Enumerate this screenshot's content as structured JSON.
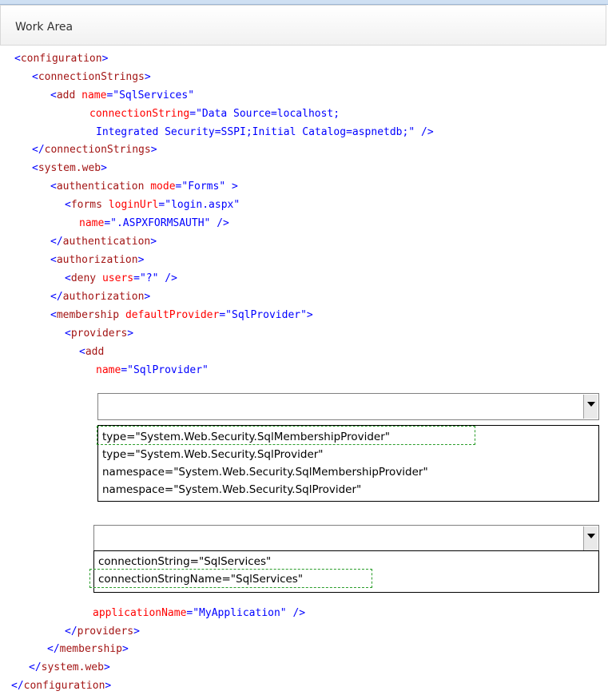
{
  "header": {
    "title": "Work Area"
  },
  "code": {
    "configuration_open": "configuration",
    "connectionStrings_open": "connectionStrings",
    "add_tag": "add",
    "name_attr": "name",
    "name_val": "\"SqlServices\"",
    "connectionString_attr": "connectionString",
    "connectionString_val1": "\"Data Source=localhost;",
    "connectionString_val2": "Integrated Security=SSPI;Initial Catalog=aspnetdb;\"",
    "connectionStrings_close": "connectionStrings",
    "system_web_open": "system.web",
    "authentication_tag": "authentication",
    "mode_attr": "mode",
    "mode_val": "\"Forms\"",
    "forms_tag": "forms",
    "loginUrl_attr": "loginUrl",
    "loginUrl_val": "\"login.aspx\"",
    "forms_name_attr": "name",
    "forms_name_val": "\".ASPXFORMSAUTH\"",
    "authentication_close": "authentication",
    "authorization_open": "authorization",
    "deny_tag": "deny",
    "users_attr": "users",
    "users_val": "\"?\"",
    "authorization_close": "authorization",
    "membership_tag": "membership",
    "defaultProvider_attr": "defaultProvider",
    "defaultProvider_val": "\"SqlProvider\"",
    "providers_open": "providers",
    "add2_tag": "add",
    "provider_name_attr": "name",
    "provider_name_val": "\"SqlProvider\"",
    "applicationName_attr": "applicationName",
    "applicationName_val": "\"MyApplication\"",
    "providers_close": "providers",
    "membership_close": "membership",
    "system_web_close": "system.web",
    "configuration_close": "configuration"
  },
  "dropdown1": {
    "selected": "",
    "options": [
      "type=\"System.Web.Security.SqlMembershipProvider\"",
      "type=\"System.Web.Security.SqlProvider\"",
      "namespace=\"System.Web.Security.SqlMembershipProvider\"",
      "namespace=\"System.Web.Security.SqlProvider\""
    ]
  },
  "dropdown2": {
    "selected": "",
    "options": [
      "connectionString=\"SqlServices\"",
      "connectionStringName=\"SqlServices\""
    ]
  },
  "colors": {
    "tag": "#a31515",
    "bracket": "#0000ff",
    "attribute": "#ff0000",
    "value": "#0000ff",
    "selection_outline": "#2a9d2a"
  }
}
